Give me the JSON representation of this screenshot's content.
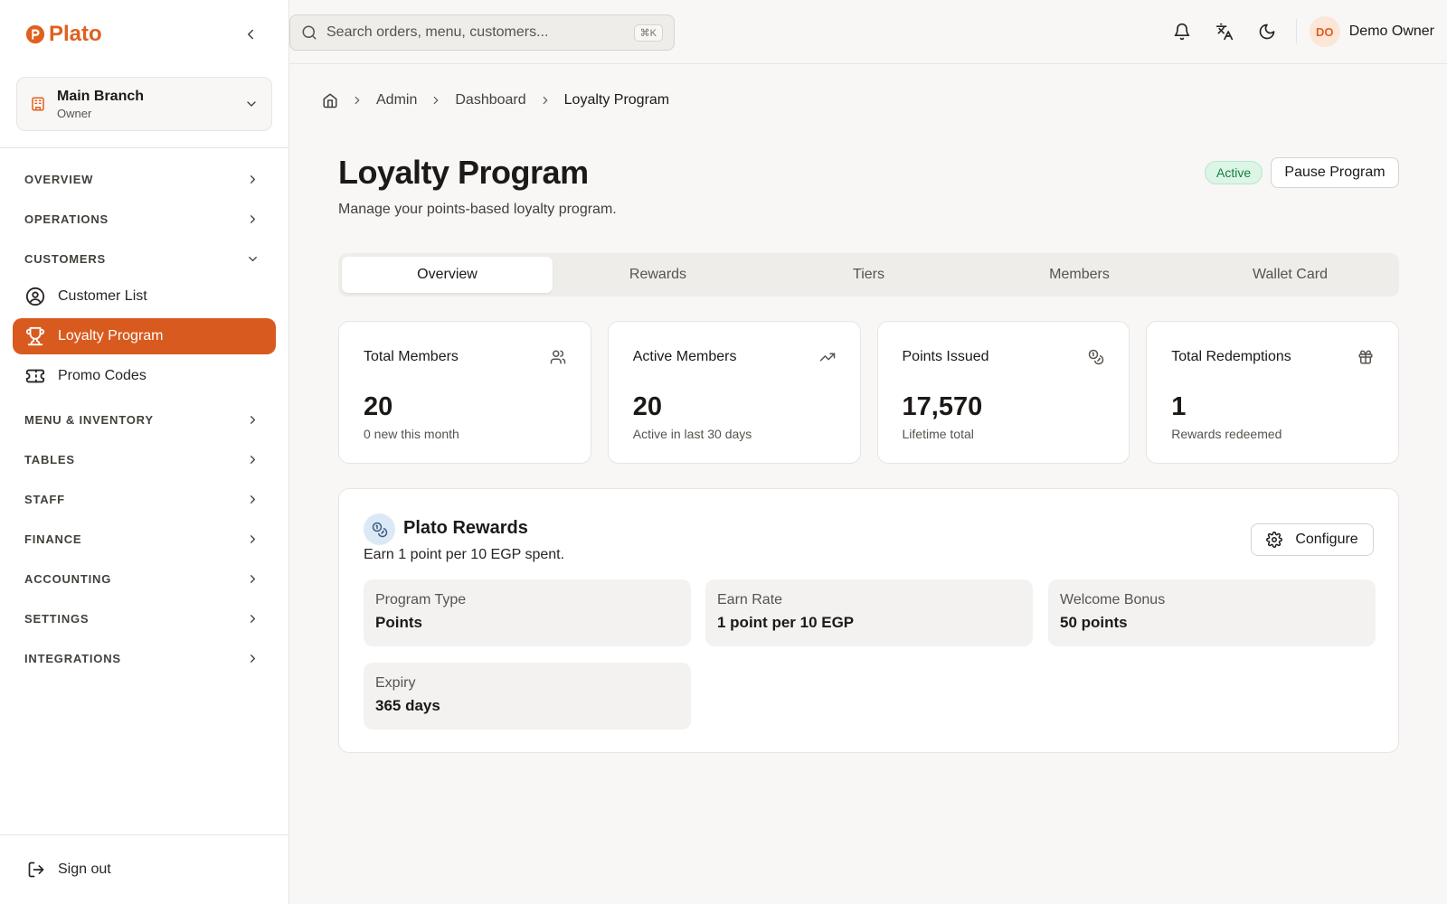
{
  "app": {
    "name": "Plato",
    "brand_color": "#d95a1e"
  },
  "branch": {
    "name": "Main Branch",
    "role": "Owner"
  },
  "sidebar": {
    "groups": [
      {
        "label": "OVERVIEW",
        "expanded": false
      },
      {
        "label": "OPERATIONS",
        "expanded": false
      },
      {
        "label": "CUSTOMERS",
        "expanded": true,
        "items": [
          {
            "label": "Customer List",
            "icon": "user-circle-icon",
            "active": false
          },
          {
            "label": "Loyalty Program",
            "icon": "trophy-icon",
            "active": true
          },
          {
            "label": "Promo Codes",
            "icon": "ticket-icon",
            "active": false
          }
        ]
      },
      {
        "label": "MENU & INVENTORY",
        "expanded": false
      },
      {
        "label": "TABLES",
        "expanded": false
      },
      {
        "label": "STAFF",
        "expanded": false
      },
      {
        "label": "FINANCE",
        "expanded": false
      },
      {
        "label": "ACCOUNTING",
        "expanded": false
      },
      {
        "label": "SETTINGS",
        "expanded": false
      },
      {
        "label": "INTEGRATIONS",
        "expanded": false
      }
    ],
    "sign_out": "Sign out"
  },
  "topbar": {
    "search_placeholder": "Search orders, menu, customers...",
    "search_shortcut": "⌘K",
    "user_initials": "DO",
    "user_name": "Demo Owner"
  },
  "breadcrumb": {
    "items": [
      "Admin",
      "Dashboard"
    ],
    "current": "Loyalty Program"
  },
  "page": {
    "title": "Loyalty Program",
    "subtitle": "Manage your points-based loyalty program.",
    "status": "Active",
    "pause_label": "Pause Program"
  },
  "tabs": [
    {
      "label": "Overview",
      "active": true
    },
    {
      "label": "Rewards",
      "active": false
    },
    {
      "label": "Tiers",
      "active": false
    },
    {
      "label": "Members",
      "active": false
    },
    {
      "label": "Wallet Card",
      "active": false
    }
  ],
  "stats": [
    {
      "label": "Total Members",
      "value": "20",
      "note": "0 new this month",
      "icon": "users-icon"
    },
    {
      "label": "Active Members",
      "value": "20",
      "note": "Active in last 30 days",
      "icon": "trending-up-icon"
    },
    {
      "label": "Points Issued",
      "value": "17,570",
      "note": "Lifetime total",
      "icon": "coins-icon"
    },
    {
      "label": "Total Redemptions",
      "value": "1",
      "note": "Rewards redeemed",
      "icon": "gift-icon"
    }
  ],
  "program": {
    "name": "Plato Rewards",
    "description": "Earn 1 point per 10 EGP spent.",
    "configure_label": "Configure",
    "details": [
      {
        "label": "Program Type",
        "value": "Points"
      },
      {
        "label": "Earn Rate",
        "value": "1 point per 10 EGP"
      },
      {
        "label": "Welcome Bonus",
        "value": "50 points"
      },
      {
        "label": "Expiry",
        "value": "365 days"
      }
    ]
  }
}
